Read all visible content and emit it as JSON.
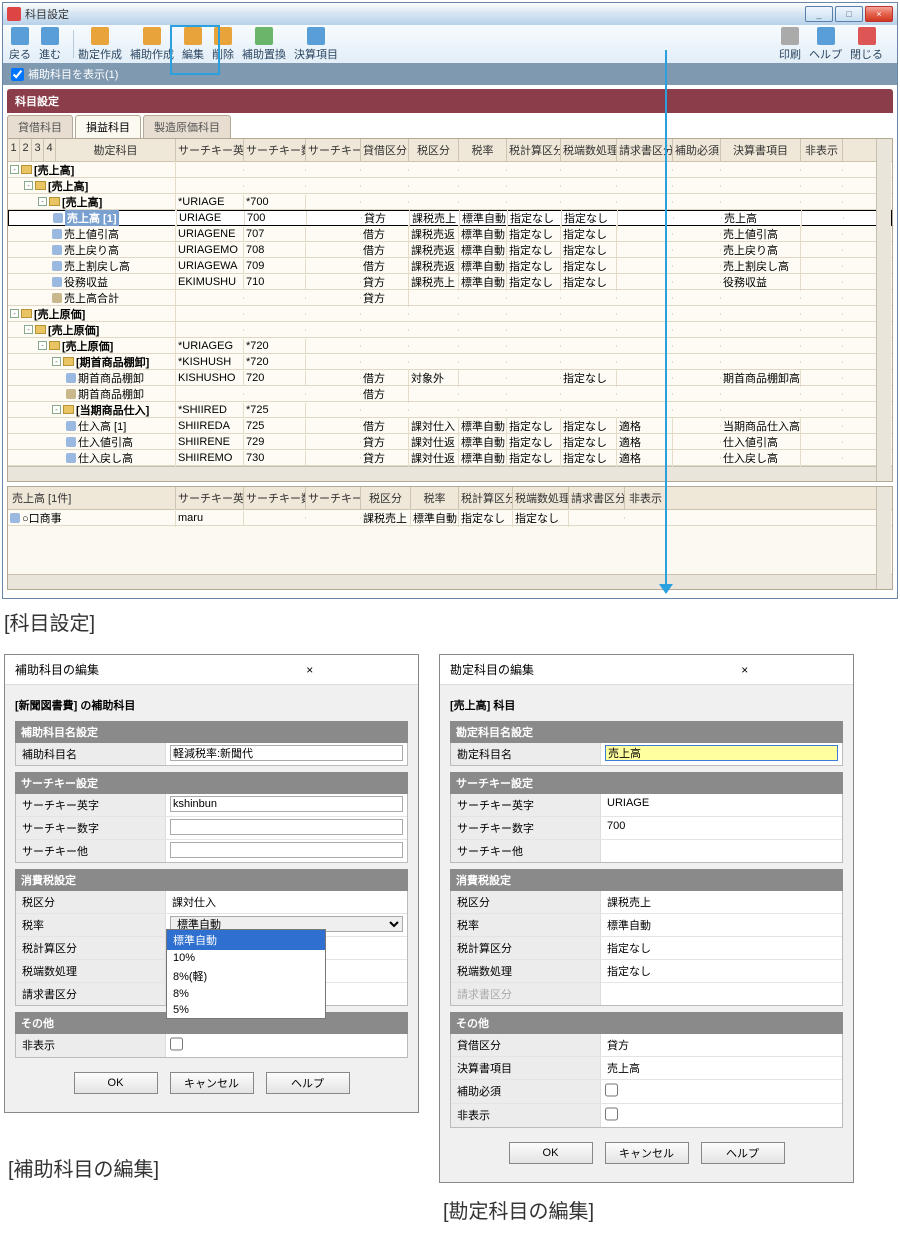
{
  "window": {
    "title": "科目設定",
    "minimize": "_",
    "maximize": "□",
    "close": "×"
  },
  "toolbar": {
    "back": "戻る",
    "forward": "進む",
    "create": "勘定作成",
    "sub_create": "補助作成",
    "edit": "編集",
    "delete": "削除",
    "sub_swap": "補助置換",
    "calc_item": "決算項目",
    "print": "印刷",
    "help": "ヘルプ",
    "close": "閉じる"
  },
  "subbar": {
    "show_sub": "補助科目を表示(1)"
  },
  "panel_title": "科目設定",
  "tabs": {
    "t1": "貸借科目",
    "t2": "損益科目",
    "t3": "製造原価科目"
  },
  "headers": {
    "lv": [
      "1",
      "2",
      "3",
      "4"
    ],
    "acc": "勘定科目",
    "sk1": "サーチキー英字",
    "sk2": "サーチキー数字",
    "sk3": "サーチキー他",
    "db": "貸借区分",
    "tax": "税区分",
    "rate": "税率",
    "calc": "税計算区分",
    "frac": "税端数処理",
    "inv": "請求書区分",
    "req": "補助必須",
    "fin": "決算書項目",
    "hide": "非表示"
  },
  "rows": [
    {
      "ind": 0,
      "type": "folder",
      "name": "[売上高]"
    },
    {
      "ind": 1,
      "type": "folder",
      "name": "[売上高]"
    },
    {
      "ind": 2,
      "type": "folder",
      "name": "[売上高]",
      "sk1": "*URIAGE",
      "sk2": "*700"
    },
    {
      "ind": 3,
      "type": "item",
      "sel": true,
      "name": "売上高 [1]",
      "sk1": "URIAGE",
      "sk2": "700",
      "db": "貸方",
      "tax": "課税売上",
      "rate": "標準自動",
      "calc": "指定なし",
      "frac": "指定なし",
      "fin": "売上高"
    },
    {
      "ind": 3,
      "type": "item",
      "name": "売上値引高",
      "sk1": "URIAGENE",
      "sk2": "707",
      "db": "借方",
      "tax": "課税売返",
      "rate": "標準自動",
      "calc": "指定なし",
      "frac": "指定なし",
      "fin": "売上値引高"
    },
    {
      "ind": 3,
      "type": "item",
      "name": "売上戻り高",
      "sk1": "URIAGEMO",
      "sk2": "708",
      "db": "借方",
      "tax": "課税売返",
      "rate": "標準自動",
      "calc": "指定なし",
      "frac": "指定なし",
      "fin": "売上戻り高"
    },
    {
      "ind": 3,
      "type": "item",
      "name": "売上割戻し高",
      "sk1": "URIAGEWA",
      "sk2": "709",
      "db": "借方",
      "tax": "課税売返",
      "rate": "標準自動",
      "calc": "指定なし",
      "frac": "指定なし",
      "fin": "売上割戻し高"
    },
    {
      "ind": 3,
      "type": "item",
      "name": "役務収益",
      "sk1": "EKIMUSHU",
      "sk2": "710",
      "db": "貸方",
      "tax": "課税売上",
      "rate": "標準自動",
      "calc": "指定なし",
      "frac": "指定なし",
      "fin": "役務収益"
    },
    {
      "ind": 3,
      "type": "calc",
      "name": "売上高合計",
      "db": "貸方"
    },
    {
      "ind": 0,
      "type": "folder",
      "name": "[売上原価]"
    },
    {
      "ind": 1,
      "type": "folder",
      "name": "[売上原価]"
    },
    {
      "ind": 2,
      "type": "folder",
      "name": "[売上原価]",
      "sk1": "*URIAGEG",
      "sk2": "*720"
    },
    {
      "ind": 3,
      "type": "folder",
      "name": "[期首商品棚卸]",
      "sk1": "*KISHUSH",
      "sk2": "*720"
    },
    {
      "ind": 4,
      "type": "item",
      "name": "期首商品棚卸",
      "sk1": "KISHUSHO",
      "sk2": "720",
      "db": "借方",
      "tax": "対象外",
      "calc": "",
      "frac": "指定なし",
      "fin": "期首商品棚卸高"
    },
    {
      "ind": 4,
      "type": "calc",
      "name": "期首商品棚卸",
      "db": "借方"
    },
    {
      "ind": 3,
      "type": "folder",
      "name": "[当期商品仕入]",
      "sk1": "*SHIIRED",
      "sk2": "*725"
    },
    {
      "ind": 4,
      "type": "item",
      "name": "仕入高 [1]",
      "sk1": "SHIIREDA",
      "sk2": "725",
      "db": "借方",
      "tax": "課対仕入",
      "rate": "標準自動",
      "calc": "指定なし",
      "frac": "指定なし",
      "inv": "適格",
      "fin": "当期商品仕入高"
    },
    {
      "ind": 4,
      "type": "item",
      "name": "仕入値引高",
      "sk1": "SHIIRENE",
      "sk2": "729",
      "db": "貸方",
      "tax": "課対仕返",
      "rate": "標準自動",
      "calc": "指定なし",
      "frac": "指定なし",
      "inv": "適格",
      "fin": "仕入値引高"
    },
    {
      "ind": 4,
      "type": "item",
      "name": "仕入戻し高",
      "sk1": "SHIIREMO",
      "sk2": "730",
      "db": "貸方",
      "tax": "課対仕返",
      "rate": "標準自動",
      "calc": "指定なし",
      "frac": "指定なし",
      "inv": "適格",
      "fin": "仕入戻し高"
    }
  ],
  "lower_grid": {
    "title": "売上高 [1件]",
    "headers": {
      "sk1": "サーチキー英字",
      "sk2": "サーチキー数字",
      "sk3": "サーチキー他",
      "tax": "税区分",
      "rate": "税率",
      "calc": "税計算区分",
      "frac": "税端数処理",
      "inv": "請求書区分",
      "hide": "非表示"
    },
    "row": {
      "name": "○口商事",
      "sk1": "maru",
      "tax": "課税売上",
      "rate": "標準自動",
      "calc": "指定なし",
      "frac": "指定なし"
    }
  },
  "main_caption": "[科目設定]",
  "dialog1": {
    "title": "補助科目の編集",
    "subtitle": "[新聞図書費] の補助科目",
    "s1": {
      "h": "補助科目名設定",
      "name_l": "補助科目名",
      "name_v": "軽減税率:新聞代"
    },
    "s2": {
      "h": "サーチキー設定",
      "l1": "サーチキー英字",
      "v1": "kshinbun",
      "l2": "サーチキー数字",
      "l3": "サーチキー他"
    },
    "s3": {
      "h": "消費税設定",
      "l1": "税区分",
      "v1": "課対仕入",
      "l2": "税率",
      "v2": "標準自動",
      "l3": "税計算区分",
      "l4": "税端数処理",
      "l5": "請求書区分",
      "dd": [
        "標準自動",
        "10%",
        "8%(軽)",
        "8%",
        "5%"
      ]
    },
    "s4": {
      "h": "その他",
      "l1": "非表示"
    },
    "ok": "OK",
    "cancel": "キャンセル",
    "help": "ヘルプ",
    "caption": "[補助科目の編集]"
  },
  "dialog2": {
    "title": "勘定科目の編集",
    "subtitle": "[売上高] 科目",
    "s1": {
      "h": "勘定科目名設定",
      "name_l": "勘定科目名",
      "name_v": "売上高"
    },
    "s2": {
      "h": "サーチキー設定",
      "l1": "サーチキー英字",
      "v1": "URIAGE",
      "l2": "サーチキー数字",
      "v2": "700",
      "l3": "サーチキー他"
    },
    "s3": {
      "h": "消費税設定",
      "l1": "税区分",
      "v1": "課税売上",
      "l2": "税率",
      "v2": "標準自動",
      "l3": "税計算区分",
      "v3": "指定なし",
      "l4": "税端数処理",
      "v4": "指定なし",
      "l5": "請求書区分"
    },
    "s4": {
      "h": "その他",
      "l1": "貸借区分",
      "v1": "貸方",
      "l2": "決算書項目",
      "v2": "売上高",
      "l3": "補助必須",
      "l4": "非表示"
    },
    "ok": "OK",
    "cancel": "キャンセル",
    "help": "ヘルプ",
    "caption": "[勘定科目の編集]"
  }
}
